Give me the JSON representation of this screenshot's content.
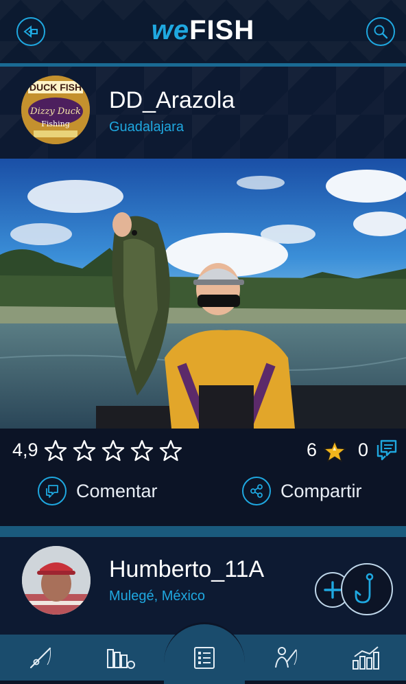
{
  "header": {
    "logo_we": "we",
    "logo_fish": "FISH",
    "back_icon": "back-arrow-icon",
    "search_icon": "search-icon"
  },
  "post": {
    "username": "DD_Arazola",
    "location": "Guadalajara",
    "avatar_text_top": "DUCK FISH",
    "avatar_text_mid": "Dizzy Duck",
    "avatar_text_sub": "Fishing",
    "rating": "4,9",
    "stars": 5,
    "favorites_count": "6",
    "comments_count": "0",
    "comment_label": "Comentar",
    "share_label": "Compartir"
  },
  "next_post": {
    "username": "Humberto_11A",
    "location": "Mulegé, México"
  },
  "nav": {
    "items": [
      "rod-icon",
      "fish-tank-icon",
      "list-icon",
      "angler-icon",
      "ranking-chart-icon"
    ],
    "active_index": 2
  },
  "colors": {
    "accent": "#1fa8e0",
    "background": "#0c1426",
    "nav": "#1a4c6d",
    "star_gold": "#f2b51c"
  }
}
